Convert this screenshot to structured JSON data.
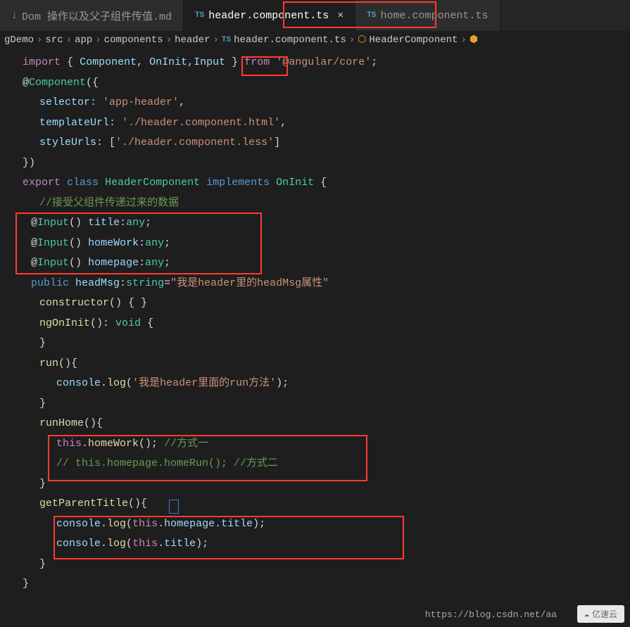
{
  "tabs": [
    {
      "icon": "md",
      "label": "Dom 操作以及父子组件传值.md",
      "active": false
    },
    {
      "icon": "ts",
      "label": "header.component.ts",
      "active": true
    },
    {
      "icon": "ts",
      "label": "home.component.ts",
      "active": false
    }
  ],
  "breadcrumb": {
    "parts": [
      "gDemo",
      "src",
      "app",
      "components",
      "header",
      "header.component.ts",
      "HeaderComponent"
    ]
  },
  "code": {
    "l1": {
      "import": "import",
      "lbrace": "{",
      "c1": "Component",
      "c2": "OnInit",
      "c3": "Input",
      "rbrace": "}",
      "from": "from",
      "pkg": "'@angular/core'",
      "semi": ";"
    },
    "l2": {
      "at": "@",
      "dec": "Component",
      "open": "({"
    },
    "l3": {
      "prop": "selector:",
      "val": "'app-header'",
      "comma": ","
    },
    "l4": {
      "prop": "templateUrl:",
      "val": "'./header.component.html'",
      "comma": ","
    },
    "l5": {
      "prop": "styleUrls:",
      "lbracket": "[",
      "val": "'./header.component.less'",
      "rbracket": "]"
    },
    "l6": {
      "close": "})"
    },
    "l7": {
      "export": "export",
      "class": "class",
      "name": "HeaderComponent",
      "impl": "implements",
      "iface": "OnInit",
      "brace": "{"
    },
    "l8": {
      "comment": "//接受父组件传递过来的数据"
    },
    "l9": {
      "at": "@",
      "dec": "Input",
      "paren": "()",
      "prop": "title",
      "colon": ":",
      "type": "any",
      "semi": ";"
    },
    "l10": {
      "at": "@",
      "dec": "Input",
      "paren": "()",
      "prop": "homeWork",
      "colon": ":",
      "type": "any",
      "semi": ";"
    },
    "l11": {
      "at": "@",
      "dec": "Input",
      "paren": "()",
      "prop": "homepage",
      "colon": ":",
      "type": "any",
      "semi": ";"
    },
    "l12": {
      "pub": "public",
      "prop": "headMsg",
      "colon": ":",
      "type": "string",
      "eq": "=",
      "val": "\"我是header里的headMsg属性\""
    },
    "l13": {
      "ctor": "constructor",
      "body": "() { }"
    },
    "l14": {
      "method": "ngOnInit",
      "paren": "():",
      "ret": "void",
      "brace": "{"
    },
    "l15": {
      "brace": "}"
    },
    "l16": {
      "method": "run",
      "body": "(){"
    },
    "l17": {
      "obj": "console",
      "dot": ".",
      "log": "log",
      "open": "(",
      "str": "'我是header里面的run方法'",
      "close": ");"
    },
    "l18": {
      "brace": "}"
    },
    "l19": {
      "method": "runHome",
      "body": "(){"
    },
    "l20": {
      "this": "this",
      "dot": ".",
      "call": "homeWork",
      "paren": "();",
      "comment": "//方式一"
    },
    "l21": {
      "comment": "// this.homepage.homeRun(); //方式二"
    },
    "l22": {
      "brace": "}"
    },
    "l23": {
      "method": "getParentTitle",
      "body": "(){"
    },
    "l24": {
      "obj": "console",
      "dot1": ".",
      "log": "log",
      "open": "(",
      "this": "this",
      "dot2": ".",
      "prop1": "homepage",
      "dot3": ".",
      "prop2": "title",
      "close": ");"
    },
    "l25": {
      "obj": "console",
      "dot1": ".",
      "log": "log",
      "open": "(",
      "this": "this",
      "dot2": ".",
      "prop": "title",
      "close": ");"
    },
    "l26": {
      "brace": "}"
    },
    "l27": {
      "brace": "}"
    }
  },
  "watermark": {
    "text": "亿速云",
    "url": "https://blog.csdn.net/aa"
  }
}
